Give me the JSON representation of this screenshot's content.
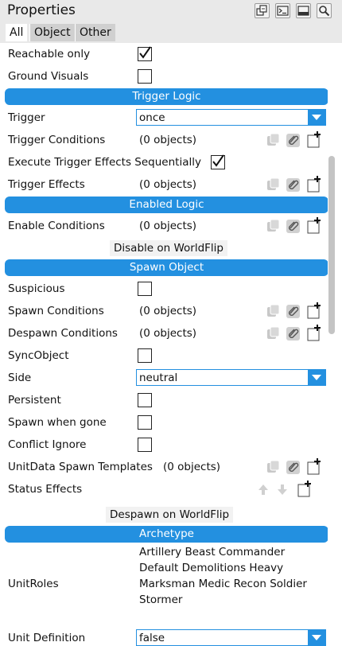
{
  "panel": {
    "title": "Properties"
  },
  "tabs": [
    {
      "label": "All",
      "active": true
    },
    {
      "label": "Object",
      "active": false
    },
    {
      "label": "Other",
      "active": false
    }
  ],
  "toolbar_icons": [
    "copy-windows-icon",
    "console-icon",
    "dock-icon",
    "search-icon"
  ],
  "colors": {
    "accent": "#2390e0",
    "header_text": "#ffffff",
    "titlebar": "#e9e9e9",
    "icon_disabled": "#c8c8c8"
  },
  "rows": {
    "reachable_only": {
      "label": "Reachable only",
      "checked": true
    },
    "ground_visuals": {
      "label": "Ground Visuals",
      "checked": false
    },
    "trigger_logic": {
      "label": "Trigger Logic"
    },
    "trigger": {
      "label": "Trigger",
      "value": "once"
    },
    "trigger_conditions": {
      "label": "Trigger Conditions",
      "value": "(0 objects)"
    },
    "execute_sequentially": {
      "label": "Execute Trigger Effects Sequentially",
      "checked": true
    },
    "trigger_effects": {
      "label": "Trigger Effects",
      "value": "(0 objects)"
    },
    "enabled_logic": {
      "label": "Enabled Logic"
    },
    "enable_conditions": {
      "label": "Enable Conditions",
      "value": "(0 objects)"
    },
    "disable_on_worldflip": {
      "label": "Disable on WorldFlip"
    },
    "spawn_object": {
      "label": "Spawn Object"
    },
    "suspicious": {
      "label": "Suspicious",
      "checked": false
    },
    "spawn_conditions": {
      "label": "Spawn Conditions",
      "value": "(0 objects)"
    },
    "despawn_conditions": {
      "label": "Despawn Conditions",
      "value": "(0 objects)"
    },
    "sync_object": {
      "label": "SyncObject",
      "checked": false
    },
    "side": {
      "label": "Side",
      "value": "neutral"
    },
    "persistent": {
      "label": "Persistent",
      "checked": false
    },
    "spawn_when_gone": {
      "label": "Spawn when gone",
      "checked": false
    },
    "conflict_ignore": {
      "label": "Conflict Ignore",
      "checked": false
    },
    "unitdata_spawn_templates": {
      "label": "UnitData Spawn Templates",
      "value": "(0 objects)"
    },
    "status_effects": {
      "label": "Status Effects"
    },
    "despawn_on_worldflip": {
      "label": "Despawn on WorldFlip"
    },
    "archetype": {
      "label": "Archetype"
    },
    "unit_roles": {
      "label": "UnitRoles",
      "lines": [
        "Artillery  Beast  Commander",
        "Default  Demolitions  Heavy",
        "Marksman  Medic  Recon  Soldier",
        "Stormer"
      ]
    },
    "unit_definition": {
      "label": "Unit Definition",
      "value": "false"
    }
  }
}
